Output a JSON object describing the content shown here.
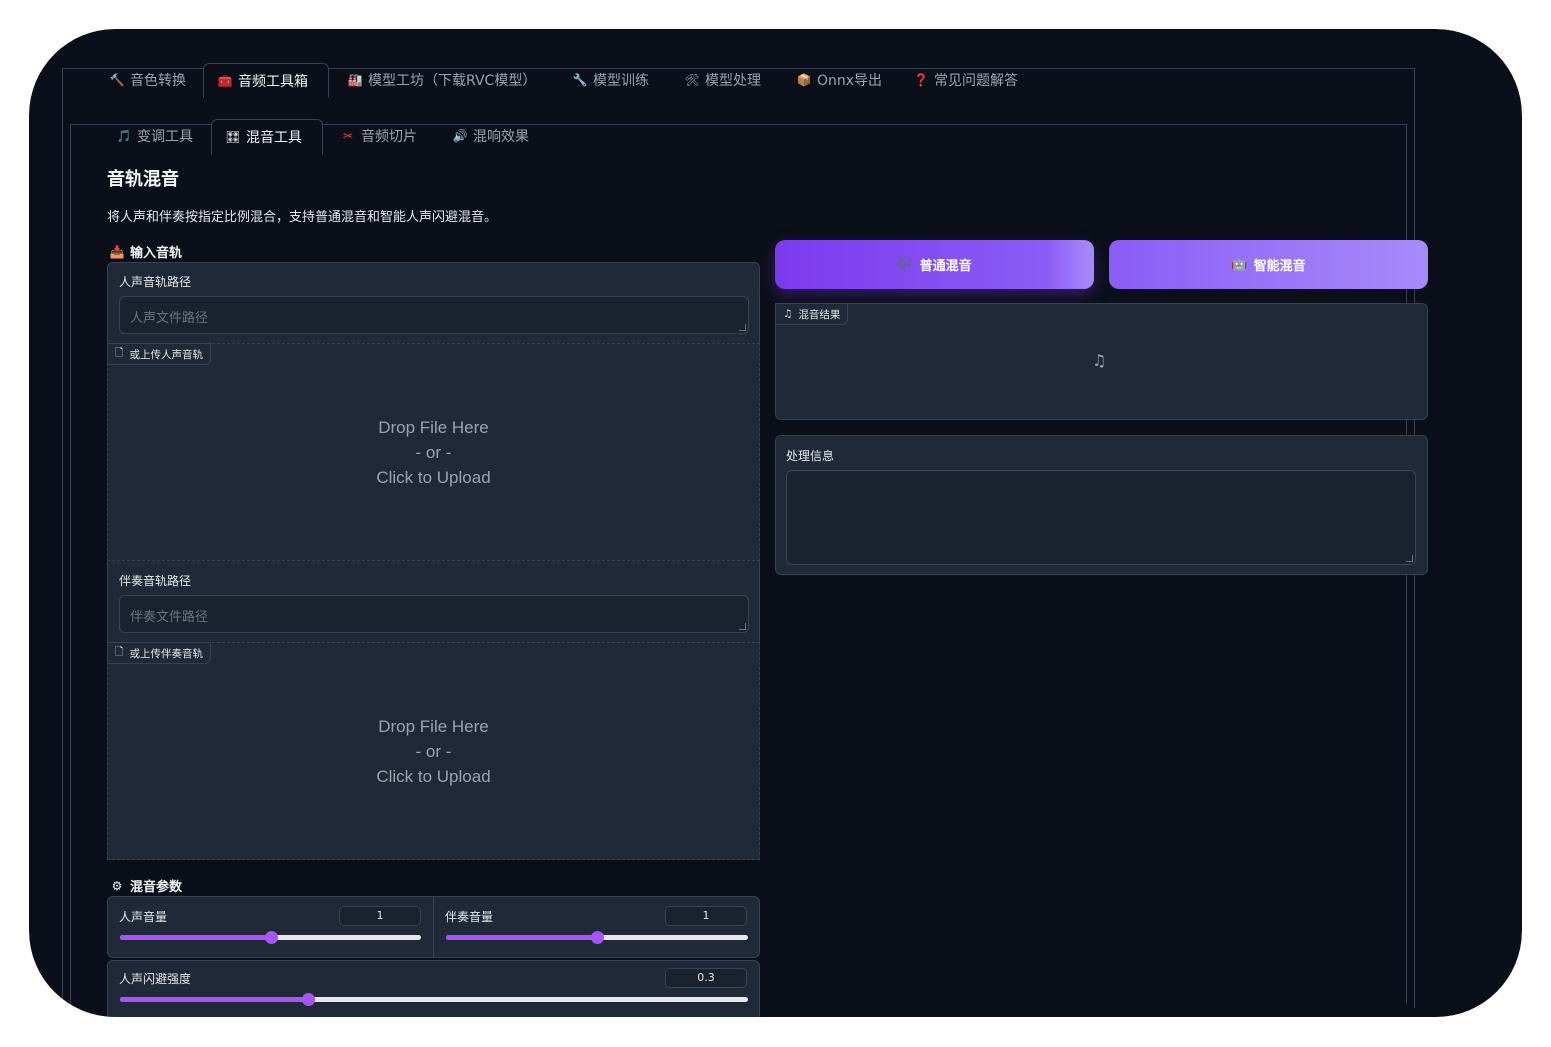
{
  "top_tabs": [
    {
      "icon": "hammer-icon",
      "glyph": "🔨",
      "label": "音色转换"
    },
    {
      "icon": "toolbox-icon",
      "glyph": "🧰",
      "label": "音频工具箱"
    },
    {
      "icon": "factory-icon",
      "glyph": "🏭",
      "label": "模型工坊（下载RVC模型）"
    },
    {
      "icon": "wrench-icon",
      "glyph": "🔧",
      "label": "模型训练"
    },
    {
      "icon": "tools-icon",
      "glyph": "🛠",
      "label": "模型处理"
    },
    {
      "icon": "package-icon",
      "glyph": "📦",
      "label": "Onnx导出"
    },
    {
      "icon": "question-icon",
      "glyph": "❓",
      "label": "常见问题解答"
    }
  ],
  "sub_tabs": [
    {
      "icon": "music-note-icon",
      "glyph": "🎵",
      "label": "变调工具"
    },
    {
      "icon": "mixer-icon",
      "glyph": "🎛",
      "label": "混音工具"
    },
    {
      "icon": "scissors-icon",
      "glyph": "✂",
      "label": "音频切片"
    },
    {
      "icon": "speaker-icon",
      "glyph": "🔊",
      "label": "混响效果"
    }
  ],
  "page": {
    "title": "音轨混音",
    "description": "将人声和伴奏按指定比例混合，支持普通混音和智能人声闪避混音。"
  },
  "input_section": {
    "label": "输入音轨",
    "vocal_path_label": "人声音轨路径",
    "vocal_path_placeholder": "人声文件路径",
    "vocal_upload_label": "或上传人声音轨",
    "accomp_path_label": "伴奏音轨路径",
    "accomp_path_placeholder": "伴奏文件路径",
    "accomp_upload_label": "或上传伴奏音轨",
    "drop_line1": "Drop File Here",
    "drop_line2": "- or -",
    "drop_line3": "Click to Upload"
  },
  "mix_params": {
    "label": "混音参数",
    "vocal_volume_label": "人声音量",
    "vocal_volume": "1",
    "vocal_volume_fraction": 0.5,
    "accomp_volume_label": "伴奏音量",
    "accomp_volume": "1",
    "accomp_volume_fraction": 0.5,
    "ducking_label": "人声闪避强度",
    "ducking": "0.3",
    "ducking_fraction": 0.3
  },
  "actions": {
    "normal_mix": "普通混音",
    "smart_mix": "智能混音"
  },
  "output": {
    "result_label": "混音结果",
    "info_label": "处理信息"
  },
  "colors": {
    "background": "#0b0f19",
    "panel": "#1f2937",
    "accent": "#a855f7",
    "button": "#7c3aed"
  }
}
